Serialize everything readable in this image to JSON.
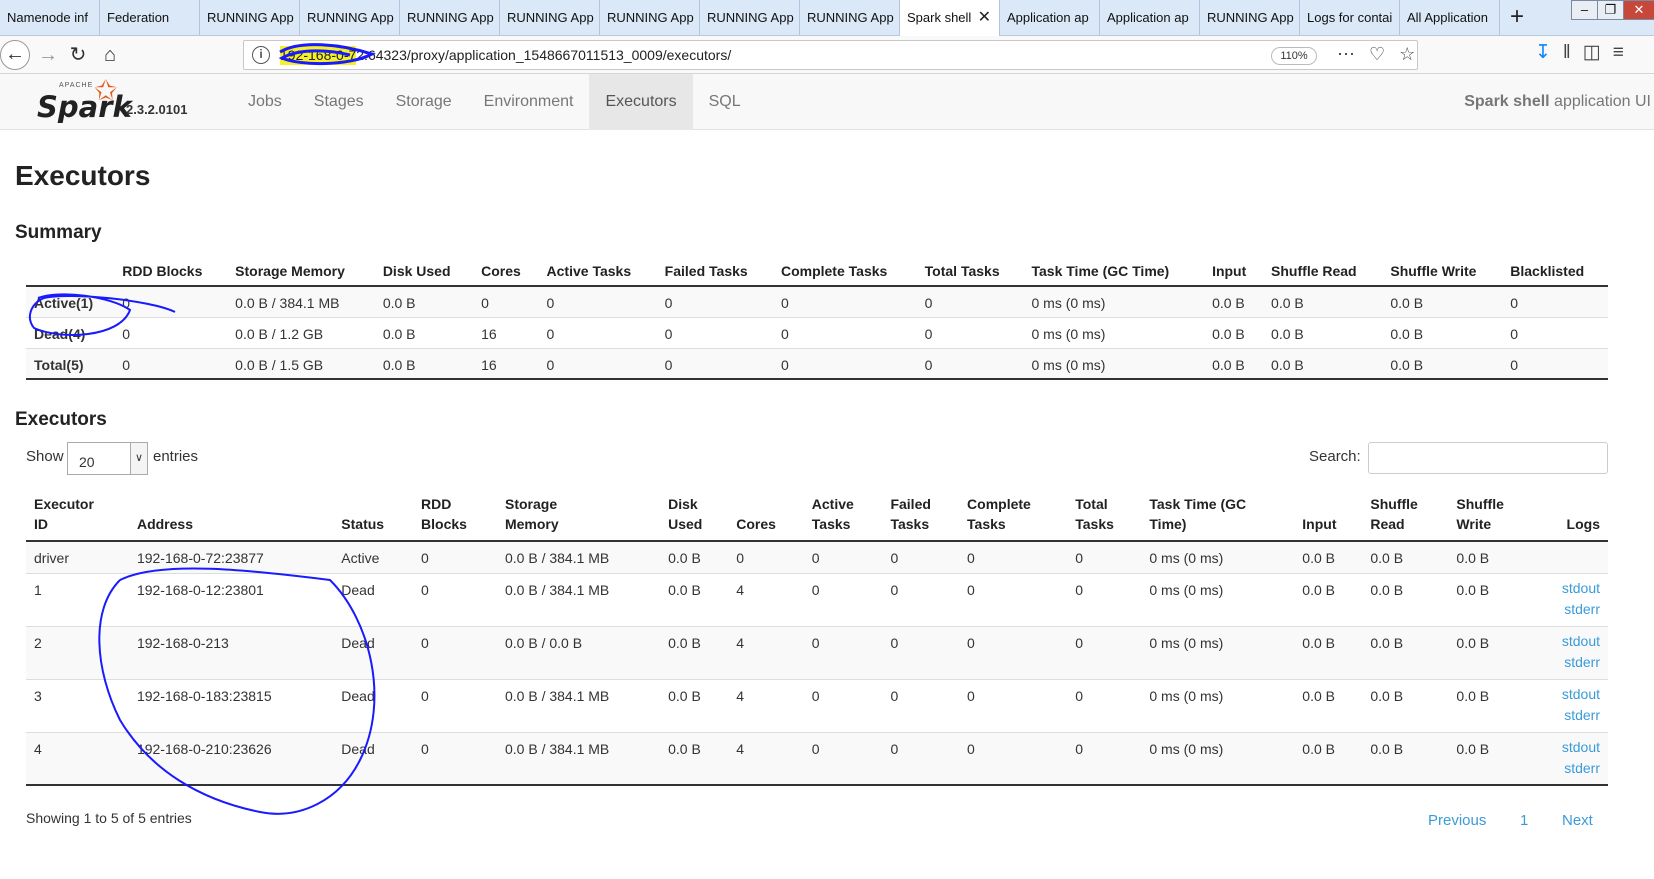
{
  "browser": {
    "tabs": [
      "Namenode inf",
      "Federation",
      "RUNNING App",
      "RUNNING App",
      "RUNNING App",
      "RUNNING App",
      "RUNNING App",
      "RUNNING App",
      "RUNNING App",
      "Spark shell",
      "Application ap",
      "Application ap",
      "RUNNING App",
      "Logs for contai",
      "All Application"
    ],
    "active_tab_index": 9,
    "url": "192-168-0-72:64323/proxy/application_1548667011513_0009/executors/",
    "zoom": "110%"
  },
  "spark": {
    "version": "2.3.2.0101",
    "menu": [
      "Jobs",
      "Stages",
      "Storage",
      "Environment",
      "Executors",
      "SQL"
    ],
    "active_menu": "Executors",
    "app_name": "Spark shell",
    "app_suffix": " application UI"
  },
  "page": {
    "title": "Executors",
    "summary_heading": "Summary",
    "executors_heading": "Executors",
    "show_label": "Show",
    "entries_value": "20",
    "entries_label": "entries",
    "search_label": "Search:",
    "showing": "Showing 1 to 5 of 5 entries",
    "previous": "Previous",
    "page_num": "1",
    "next": "Next"
  },
  "summary": {
    "headers": [
      "",
      "RDD Blocks",
      "Storage Memory",
      "Disk Used",
      "Cores",
      "Active Tasks",
      "Failed Tasks",
      "Complete Tasks",
      "Total Tasks",
      "Task Time (GC Time)",
      "Input",
      "Shuffle Read",
      "Shuffle Write",
      "Blacklisted"
    ],
    "rows": [
      [
        "Active(1)",
        "0",
        "0.0 B / 384.1 MB",
        "0.0 B",
        "0",
        "0",
        "0",
        "0",
        "0",
        "0 ms (0 ms)",
        "0.0 B",
        "0.0 B",
        "0.0 B",
        "0"
      ],
      [
        "Dead(4)",
        "0",
        "0.0 B / 1.2 GB",
        "0.0 B",
        "16",
        "0",
        "0",
        "0",
        "0",
        "0 ms (0 ms)",
        "0.0 B",
        "0.0 B",
        "0.0 B",
        "0"
      ],
      [
        "Total(5)",
        "0",
        "0.0 B / 1.5 GB",
        "0.0 B",
        "16",
        "0",
        "0",
        "0",
        "0",
        "0 ms (0 ms)",
        "0.0 B",
        "0.0 B",
        "0.0 B",
        "0"
      ]
    ]
  },
  "executors": {
    "headers": [
      [
        "Executor",
        "ID"
      ],
      [
        "",
        "Address"
      ],
      [
        "",
        "Status"
      ],
      [
        "RDD",
        "Blocks"
      ],
      [
        "Storage",
        "Memory"
      ],
      [
        "Disk",
        "Used"
      ],
      [
        "",
        "Cores"
      ],
      [
        "Active",
        "Tasks"
      ],
      [
        "Failed",
        "Tasks"
      ],
      [
        "Complete",
        "Tasks"
      ],
      [
        "Total",
        "Tasks"
      ],
      [
        "Task Time (GC",
        "Time)"
      ],
      [
        "",
        "Input"
      ],
      [
        "Shuffle",
        "Read"
      ],
      [
        "Shuffle",
        "Write"
      ],
      [
        "",
        "Logs"
      ]
    ],
    "rows": [
      [
        "driver",
        "192-168-0-72:23877",
        "Active",
        "0",
        "0.0 B / 384.1 MB",
        "0.0 B",
        "0",
        "0",
        "0",
        "0",
        "0",
        "0 ms (0 ms)",
        "0.0 B",
        "0.0 B",
        "0.0 B"
      ],
      [
        "1",
        "192-168-0-12:23801",
        "Dead",
        "0",
        "0.0 B / 384.1 MB",
        "0.0 B",
        "4",
        "0",
        "0",
        "0",
        "0",
        "0 ms (0 ms)",
        "0.0 B",
        "0.0 B",
        "0.0 B"
      ],
      [
        "2",
        "192-168-0-213",
        "Dead",
        "0",
        "0.0 B / 0.0 B",
        "0.0 B",
        "4",
        "0",
        "0",
        "0",
        "0",
        "0 ms (0 ms)",
        "0.0 B",
        "0.0 B",
        "0.0 B"
      ],
      [
        "3",
        "192-168-0-183:23815",
        "Dead",
        "0",
        "0.0 B / 384.1 MB",
        "0.0 B",
        "4",
        "0",
        "0",
        "0",
        "0",
        "0 ms (0 ms)",
        "0.0 B",
        "0.0 B",
        "0.0 B"
      ],
      [
        "4",
        "192-168-0-210:23626",
        "Dead",
        "0",
        "0.0 B / 384.1 MB",
        "0.0 B",
        "4",
        "0",
        "0",
        "0",
        "0",
        "0 ms (0 ms)",
        "0.0 B",
        "0.0 B",
        "0.0 B"
      ]
    ],
    "log_links": [
      "stdout",
      "stderr"
    ]
  },
  "colors": {
    "link": "#3a9bd9",
    "ink_annotation": "#1a1aff",
    "highlight": "#f4f02a"
  }
}
